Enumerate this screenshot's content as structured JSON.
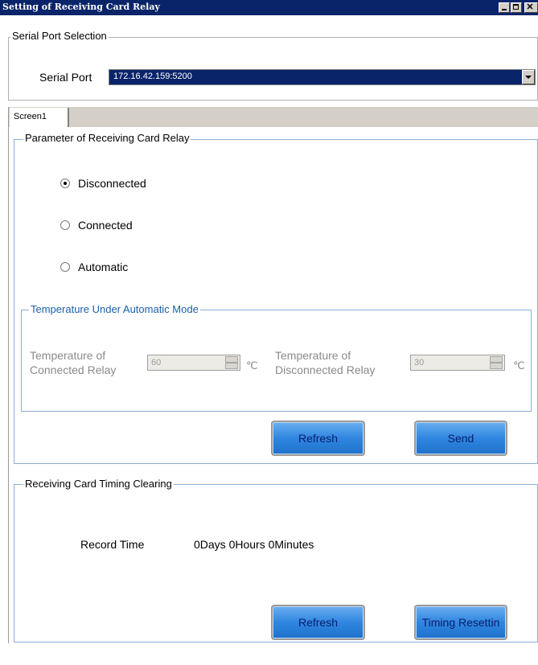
{
  "window": {
    "title": "Setting of Receiving Card Relay"
  },
  "serial_port": {
    "group_label": "Serial Port Selection",
    "label": "Serial Port",
    "selected_value": "172.16.42.159:5200"
  },
  "tabs": [
    {
      "label": "Screen1"
    }
  ],
  "relay": {
    "group_label": "Parameter of Receiving Card Relay",
    "options": [
      {
        "label": "Disconnected",
        "checked": true
      },
      {
        "label": "Connected",
        "checked": false
      },
      {
        "label": "Automatic",
        "checked": false
      }
    ],
    "temperature": {
      "group_label": "Temperature Under Automatic Mode",
      "connected": {
        "label_line1": "Temperature of",
        "label_line2": "Connected Relay",
        "value": "60",
        "unit": "℃"
      },
      "disconnected": {
        "label_line1": "Temperature of",
        "label_line2": "Disconnected Relay",
        "value": "30",
        "unit": "℃"
      }
    },
    "refresh_label": "Refresh",
    "send_label": "Send"
  },
  "timing": {
    "group_label": "Receiving Card Timing Clearing",
    "record_time_label": "Record Time",
    "record_time_value": "0Days 0Hours 0Minutes",
    "refresh_label": "Refresh",
    "reset_label": "Timing Resettin"
  }
}
